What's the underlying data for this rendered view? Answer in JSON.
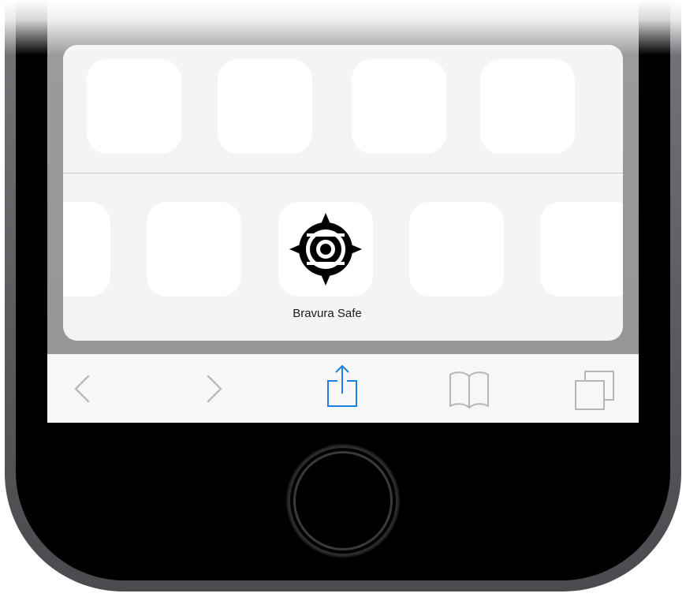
{
  "share_sheet": {
    "featured_app": {
      "label": "Bravura Safe",
      "icon": "bravura-safe-logo-icon"
    }
  },
  "toolbar": {
    "items": [
      {
        "name": "back",
        "icon": "chevron-left-icon",
        "enabled": false
      },
      {
        "name": "forward",
        "icon": "chevron-right-icon",
        "enabled": false
      },
      {
        "name": "share",
        "icon": "share-icon",
        "enabled": true
      },
      {
        "name": "bookmarks",
        "icon": "book-icon",
        "enabled": false
      },
      {
        "name": "tabs",
        "icon": "tabs-icon",
        "enabled": false
      }
    ]
  },
  "colors": {
    "accent": "#1a7fe0",
    "disabled": "#b6b6b6",
    "sheet_bg": "#f4f4f4",
    "tile_bg": "#ffffff",
    "bezel": "#000000"
  }
}
